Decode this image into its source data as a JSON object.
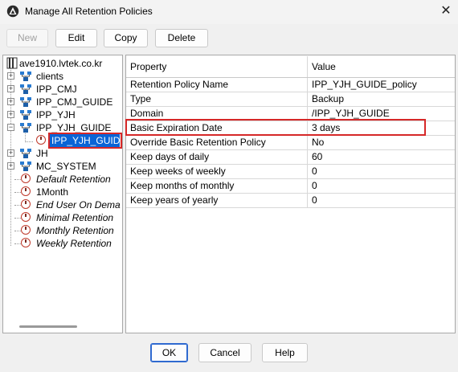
{
  "window": {
    "title": "Manage All Retention Policies",
    "close_glyph": "✕",
    "icon": "app-logo-icon"
  },
  "toolbar": {
    "new_label": "New",
    "edit_label": "Edit",
    "copy_label": "Copy",
    "delete_label": "Delete"
  },
  "tree": {
    "root": "ave1910.lvtek.co.kr",
    "domains": [
      "clients",
      "IPP_CMJ",
      "IPP_CMJ_GUIDE",
      "IPP_YJH",
      "IPP_YJH_GUIDE"
    ],
    "selected_child": "IPP_YJH_GUIDE_policy",
    "selected_visible": "IPP_YJH_GUID",
    "more_domains": [
      "JH",
      "MC_SYSTEM"
    ],
    "policies": [
      "Default Retention",
      "1Month",
      "End User On Dema",
      "Minimal Retention",
      "Monthly Retention",
      "Weekly Retention"
    ]
  },
  "grid": {
    "headers": {
      "property": "Property",
      "value": "Value"
    },
    "rows": [
      {
        "property": "Retention Policy Name",
        "value": "IPP_YJH_GUIDE_policy"
      },
      {
        "property": "Type",
        "value": "Backup"
      },
      {
        "property": "Domain",
        "value": "/IPP_YJH_GUIDE"
      },
      {
        "property": "Basic Expiration Date",
        "value": "3 days"
      },
      {
        "property": "Override Basic Retention Policy",
        "value": "No"
      },
      {
        "property": "Keep days of daily",
        "value": "60"
      },
      {
        "property": "Keep weeks of weekly",
        "value": "0"
      },
      {
        "property": "Keep months of monthly",
        "value": "0"
      },
      {
        "property": "Keep years of yearly",
        "value": "0"
      }
    ]
  },
  "footer": {
    "ok_label": "OK",
    "cancel_label": "Cancel",
    "help_label": "Help"
  },
  "colors": {
    "selection": "#0a64d6",
    "highlight": "#d62828"
  }
}
